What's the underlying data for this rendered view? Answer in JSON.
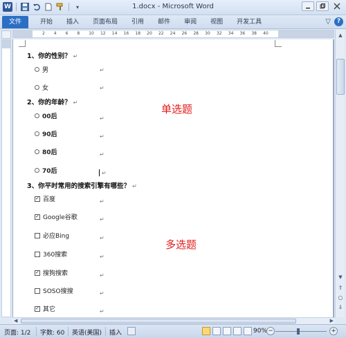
{
  "window": {
    "title": "1.docx - Microsoft Word",
    "qat": {
      "logo_letter": "W"
    }
  },
  "ribbon": {
    "file_tab": "文件",
    "tabs": [
      "开始",
      "插入",
      "页面布局",
      "引用",
      "邮件",
      "审阅",
      "视图",
      "开发工具"
    ]
  },
  "ruler": {
    "numbers": [
      "2",
      "4",
      "6",
      "8",
      "10",
      "12",
      "14",
      "16",
      "18",
      "20",
      "22",
      "24",
      "26",
      "28",
      "30",
      "32",
      "34",
      "36",
      "38",
      "40"
    ]
  },
  "document": {
    "q1": {
      "title": "1、你的性别？",
      "options": [
        "男",
        "女"
      ]
    },
    "q2": {
      "title": "2、你的年龄？",
      "options": [
        "00后",
        "90后",
        "80后",
        "70后"
      ]
    },
    "q3": {
      "title": "3、你平时常用的搜索引擎有哪些？",
      "options": [
        {
          "label": "百度",
          "checked": true
        },
        {
          "label": "Google谷歌",
          "checked": true
        },
        {
          "label": "必应Bing",
          "checked": false
        },
        {
          "label": "360搜索",
          "checked": false
        },
        {
          "label": "搜狗搜索",
          "checked": true
        },
        {
          "label": "SOSO搜搜",
          "checked": false
        },
        {
          "label": "其它",
          "checked": true
        }
      ]
    },
    "paragraph_mark": "↵",
    "annotations": {
      "single": "单选题",
      "multi": "多选题"
    }
  },
  "statusbar": {
    "page": "页面: 1/2",
    "words": "字数: 60",
    "language": "英语(美国)",
    "insert_mode": "插入",
    "zoom": "90%",
    "zoom_level_fraction": 0.45
  },
  "colors": {
    "file_tab": "#2b6fc4",
    "annotation": "#e31b1b"
  }
}
